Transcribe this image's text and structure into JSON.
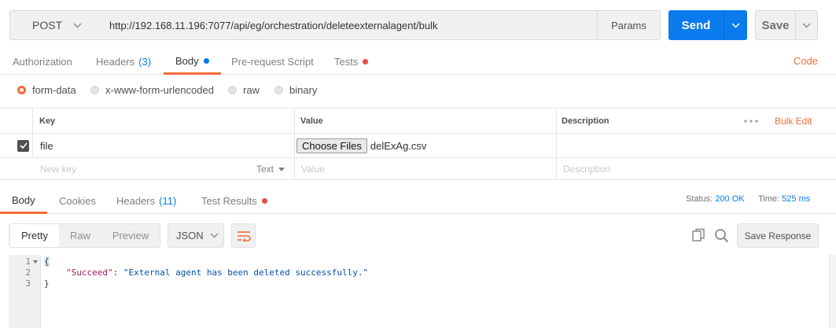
{
  "request": {
    "method": "POST",
    "url": "http://192.168.11.196:7077/api/eg/orchestration/deleteexternalagent/bulk",
    "params_label": "Params",
    "send_label": "Send",
    "save_label": "Save"
  },
  "request_tabs": {
    "authorization": "Authorization",
    "headers": "Headers",
    "headers_count": "(3)",
    "body": "Body",
    "prerequest": "Pre-request Script",
    "tests": "Tests",
    "code": "Code"
  },
  "body_types": {
    "form_data": "form-data",
    "urlencoded": "x-www-form-urlencoded",
    "raw": "raw",
    "binary": "binary",
    "selected": "form-data"
  },
  "form_table": {
    "headers": {
      "key": "Key",
      "value": "Value",
      "description": "Description"
    },
    "bulk_edit": "Bulk Edit",
    "rows": [
      {
        "checked": true,
        "key": "file",
        "choose_files_label": "Choose Files",
        "file_name": "delExAg.csv",
        "description": ""
      }
    ],
    "new_row": {
      "key_placeholder": "New key",
      "type": "Text",
      "value_placeholder": "Value",
      "description_placeholder": "Description"
    }
  },
  "response_tabs": {
    "body": "Body",
    "cookies": "Cookies",
    "headers": "Headers",
    "headers_count": "(11)",
    "test_results": "Test Results"
  },
  "response_status": {
    "status_label": "Status:",
    "status_value": "200 OK",
    "time_label": "Time:",
    "time_value": "525 ms"
  },
  "response_toolbar": {
    "pretty": "Pretty",
    "raw": "Raw",
    "preview": "Preview",
    "format": "JSON",
    "save_response": "Save Response"
  },
  "response_body": {
    "line_numbers": [
      "1",
      "2",
      "3"
    ],
    "open_brace": "{",
    "key": "\"Succeed\"",
    "colon": ": ",
    "value": "\"External agent has been deleted successfully.\"",
    "close_brace": "}"
  },
  "colors": {
    "accent": "#f26b3a",
    "primary": "#097bed",
    "error_dot": "#ed4b48"
  }
}
